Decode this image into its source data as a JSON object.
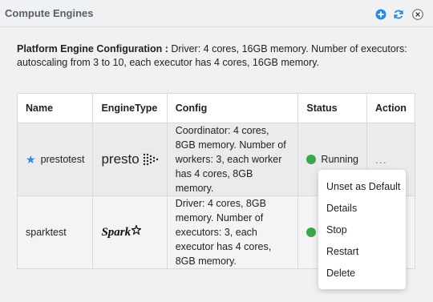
{
  "header": {
    "title": "Compute Engines"
  },
  "summary": {
    "label": "Platform Engine Configuration :",
    "text": " Driver: 4 cores, 16GB memory. Number of executors: autoscaling from 3 to 10, each executor has 4 cores, 16GB memory."
  },
  "table": {
    "headers": {
      "name": "Name",
      "engine_type": "EngineType",
      "config": "Config",
      "status": "Status",
      "action": "Action"
    },
    "rows": [
      {
        "name": "prestotest",
        "engine_logo": "presto",
        "config": "Coordinator: 4 cores, 8GB memory. Number of workers: 3, each worker has 4 cores, 8GB memory.",
        "status": "Running",
        "action": "..."
      },
      {
        "name": "sparktest",
        "engine_logo": "Spark",
        "config": "Driver: 4 cores, 8GB memory. Number of executors: 3, each executor has 4 cores, 8GB memory."
      }
    ]
  },
  "menu": {
    "items": [
      "Unset as Default",
      "Details",
      "Stop",
      "Restart",
      "Delete"
    ]
  },
  "colors": {
    "accent": "#2a8ae6",
    "running": "#3ba64a"
  }
}
